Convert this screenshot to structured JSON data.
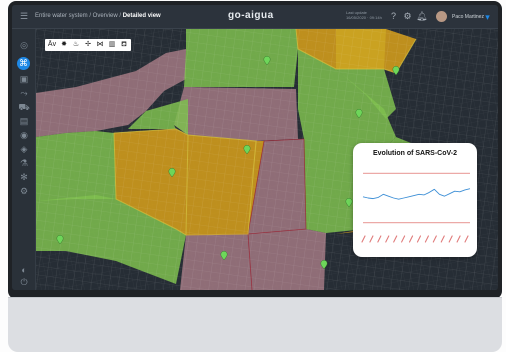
{
  "topbar": {
    "breadcrumb": "Entire water system / Overview / ",
    "breadcrumb_current": "Detailed view",
    "logo": "go-aigua",
    "status_line_1": "Last update",
    "status_line_2": "16/05/2020 · 09:14h",
    "user_name": "Paco Martinez"
  },
  "layers_toolbar": {
    "items": [
      "Āv",
      "✸",
      "♨",
      "✢",
      "⋈",
      "▥",
      "⛾"
    ]
  },
  "chart_popup": {
    "title": "Evolution of SARS-CoV-2"
  },
  "chart_data": {
    "type": "line",
    "title": "Evolution of SARS-CoV-2",
    "x_tick_count": 14,
    "series": [
      {
        "color": "#3d8fd6",
        "values": [
          5.2,
          5.0,
          4.9,
          5.1,
          5.6,
          5.3,
          5.0,
          4.8,
          5.0,
          5.2,
          5.4,
          5.6,
          5.5,
          5.9,
          6.4,
          5.6,
          5.3,
          5.7,
          6.1,
          6.0,
          6.3,
          6.5
        ]
      }
    ],
    "thresholds": [
      {
        "value": 9,
        "color": "#d9534f"
      },
      {
        "value": 1,
        "color": "#d9534f"
      }
    ],
    "ylim": [
      0,
      10
    ],
    "grid": false
  },
  "map": {
    "zone_colors": {
      "green": "#7fbf4f",
      "orange": "#d9a11a",
      "red": "#b97e87"
    },
    "marker_color": "#6ed65a",
    "marker_count": 9
  },
  "colors": {
    "accent": "#1e88e5",
    "map_background": "#262d35"
  }
}
